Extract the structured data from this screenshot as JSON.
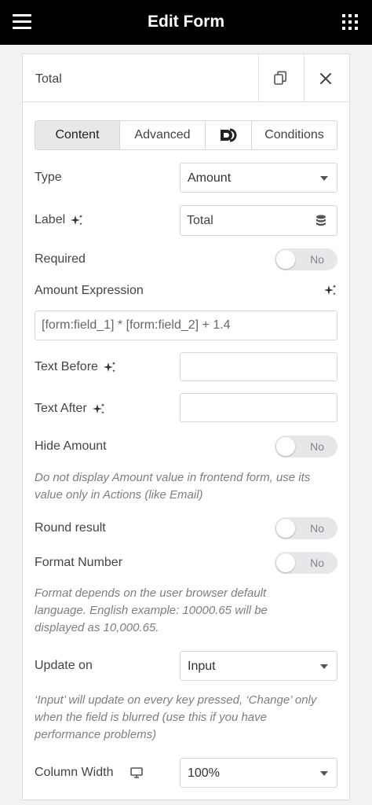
{
  "header": {
    "title": "Edit Form"
  },
  "item": {
    "label": "Total"
  },
  "tabs": [
    {
      "label": "Content",
      "active": true
    },
    {
      "label": "Advanced",
      "active": false
    },
    {
      "label": "",
      "icon": "dynamic-logo-icon",
      "active": false
    },
    {
      "label": "Conditions",
      "active": false
    }
  ],
  "fields": {
    "type": {
      "label": "Type",
      "value": "Amount"
    },
    "label": {
      "label": "Label",
      "value": "Total"
    },
    "required": {
      "label": "Required",
      "state": "No"
    },
    "amount_expression": {
      "label": "Amount Expression",
      "value": "[form:field_1] * [form:field_2] + 1.4"
    },
    "text_before": {
      "label": "Text Before",
      "value": ""
    },
    "text_after": {
      "label": "Text After",
      "value": ""
    },
    "hide_amount": {
      "label": "Hide Amount",
      "state": "No",
      "desc_line1": "Do not display Amount value in frontend form, use its",
      "desc_line2": "value only in Actions (like Email)"
    },
    "round_result": {
      "label": "Round result",
      "state": "No"
    },
    "format_number": {
      "label": "Format Number",
      "state": "No",
      "desc_line1": "Format depends on the user browser default",
      "desc_line2": "language. English example: 10000.65 will be",
      "desc_line3": "displayed as 10,000.65."
    },
    "update_on": {
      "label": "Update on",
      "value": "Input",
      "desc_line1": "‘Input’ will update on every key pressed, ‘Change’ only",
      "desc_line2": "when the field is blurred (use this if you have",
      "desc_line3": "performance problems)"
    },
    "column_width": {
      "label": "Column Width",
      "value": "100%"
    }
  },
  "colors": {
    "topbar": "#000000",
    "panel_bg": "#f2f2f3",
    "active_tab": "#e7e8ea",
    "toggle_off": "#e6e7e9",
    "help_text": "#7b7f84"
  }
}
